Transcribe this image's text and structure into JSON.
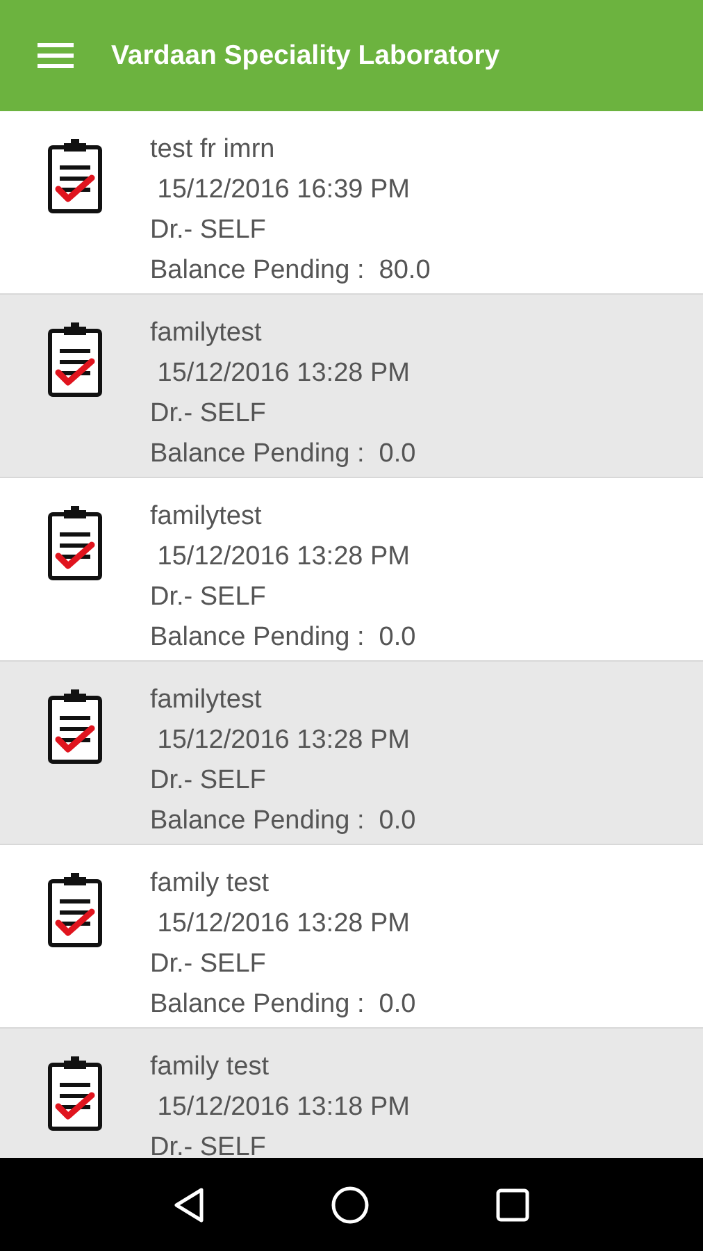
{
  "app_bar": {
    "title": "Vardaan Speciality Laboratory"
  },
  "records": [
    {
      "name": "test fr imrn",
      "date": " 15/12/2016 16:39 PM",
      "doctor": "Dr.- SELF",
      "balance": "Balance Pending :  80.0"
    },
    {
      "name": "familytest",
      "date": " 15/12/2016 13:28 PM",
      "doctor": "Dr.- SELF",
      "balance": "Balance Pending :  0.0"
    },
    {
      "name": "familytest",
      "date": " 15/12/2016 13:28 PM",
      "doctor": "Dr.- SELF",
      "balance": "Balance Pending :  0.0"
    },
    {
      "name": "familytest",
      "date": " 15/12/2016 13:28 PM",
      "doctor": "Dr.- SELF",
      "balance": "Balance Pending :  0.0"
    },
    {
      "name": "family test",
      "date": " 15/12/2016 13:28 PM",
      "doctor": "Dr.- SELF",
      "balance": "Balance Pending :  0.0"
    },
    {
      "name": "family test",
      "date": " 15/12/2016 13:18 PM",
      "doctor": "Dr.- SELF"
    }
  ]
}
